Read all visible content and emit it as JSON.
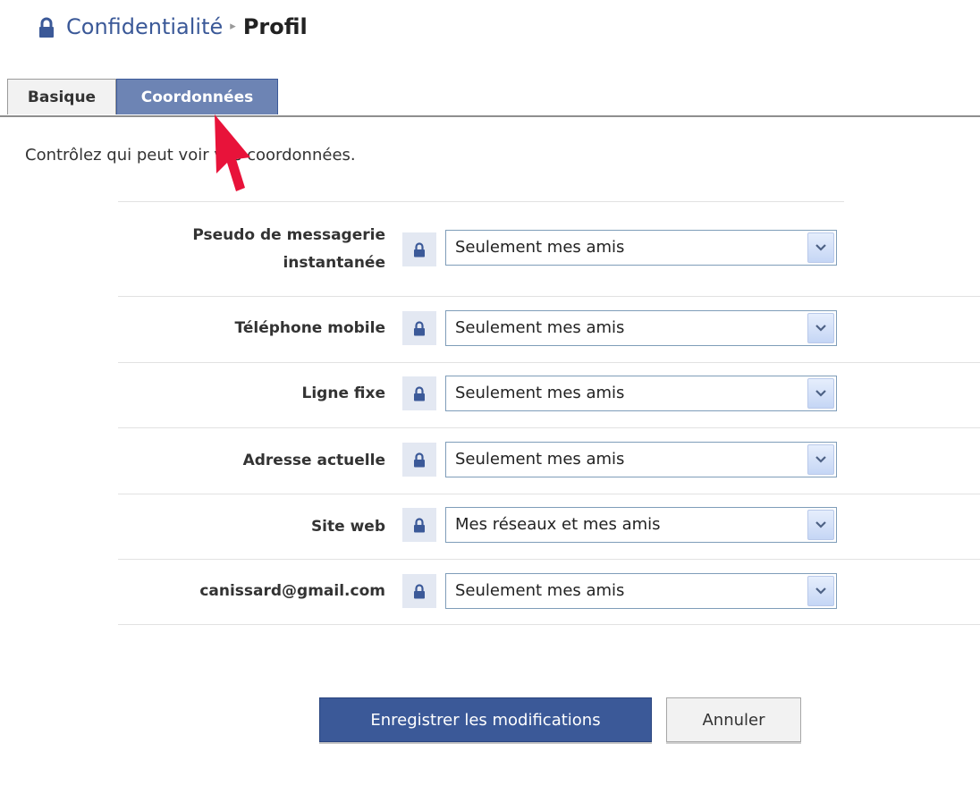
{
  "breadcrumb": {
    "parent": "Confidentialité",
    "separator": "▸",
    "current": "Profil"
  },
  "tabs": [
    {
      "label": "Basique",
      "active": false
    },
    {
      "label": "Coordonnées",
      "active": true
    }
  ],
  "intro": "Contrôlez qui peut voir vos coordonnées.",
  "rows": [
    {
      "label_line1": "Pseudo de messagerie",
      "label_line2": "instantanée",
      "value": "Seulement mes amis"
    },
    {
      "label": "Téléphone mobile",
      "value": "Seulement mes amis"
    },
    {
      "label": "Ligne fixe",
      "value": "Seulement mes amis"
    },
    {
      "label": "Adresse actuelle",
      "value": "Seulement mes amis"
    },
    {
      "label": "Site web",
      "value": "Mes réseaux et mes amis"
    },
    {
      "label": "canissard@gmail.com",
      "value": "Seulement mes amis"
    }
  ],
  "buttons": {
    "save": "Enregistrer les modifications",
    "cancel": "Annuler"
  },
  "icons": {
    "breadcrumb": "lock-icon",
    "row": "lock-icon",
    "dropdown": "chevron-down-icon",
    "pointer": "red-arrow-pointer"
  },
  "colors": {
    "brand": "#3b5998",
    "active_tab": "#6d84b4",
    "lock_bg": "#e3e8f2",
    "arrow": "#e8133a"
  }
}
